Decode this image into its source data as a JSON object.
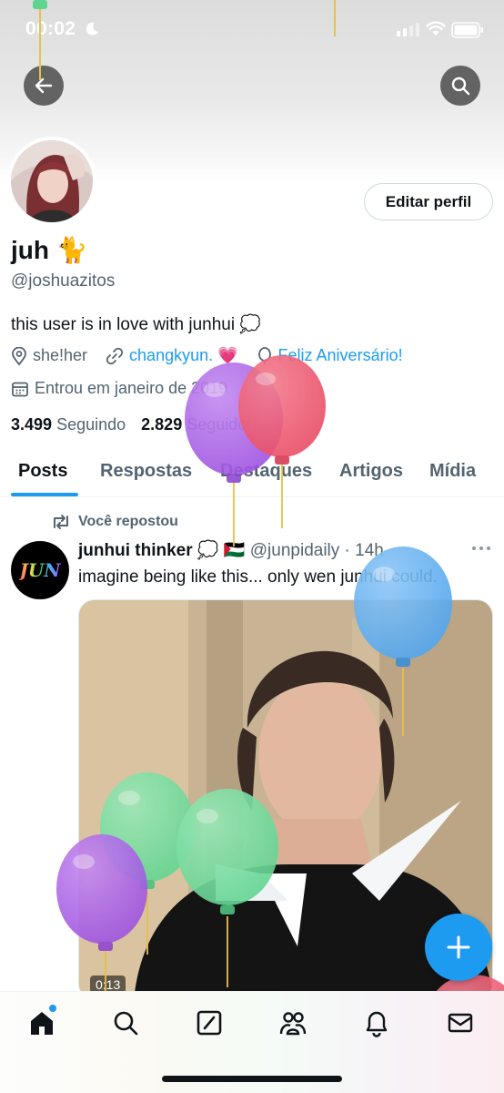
{
  "status_bar": {
    "time": "00:02"
  },
  "profile": {
    "name": "juh 🐈",
    "handle": "@joshuazitos",
    "bio": "this user is in love with junhui 💭",
    "pronouns": "she!her",
    "link": "changkyun. 💗",
    "birthday": "Feliz Aniversário!",
    "joined": "Entrou em janeiro de 2019",
    "following_count": "3.499",
    "following_label": "Seguindo",
    "followers_count": "2.829",
    "followers_label": "Seguidores",
    "edit_button": "Editar perfil"
  },
  "tabs": [
    "Posts",
    "Respostas",
    "Destaques",
    "Artigos",
    "Mídia"
  ],
  "post": {
    "repost_label": "Você repostou",
    "author": "junhui thinker 💭 🇵🇸",
    "handle_time": "@junpidaily · 14h",
    "text": "imagine being like this... only wen junhui could.",
    "avatar_text": "JUN",
    "media_duration": "0:13"
  },
  "colors": {
    "accent": "#1d9bf0",
    "text": "#0f1419",
    "secondary": "#536471",
    "balloon_purple": "#9b4fe0",
    "balloon_red": "#ea4a63",
    "balloon_blue": "#4ea4ee",
    "balloon_green": "#5fd48f"
  },
  "icons": {
    "back": "arrow-left-icon",
    "search": "search-icon",
    "compose": "plus-icon",
    "nav": [
      "home-icon",
      "search-icon",
      "grok-icon",
      "communities-icon",
      "bell-icon",
      "mail-icon"
    ]
  }
}
